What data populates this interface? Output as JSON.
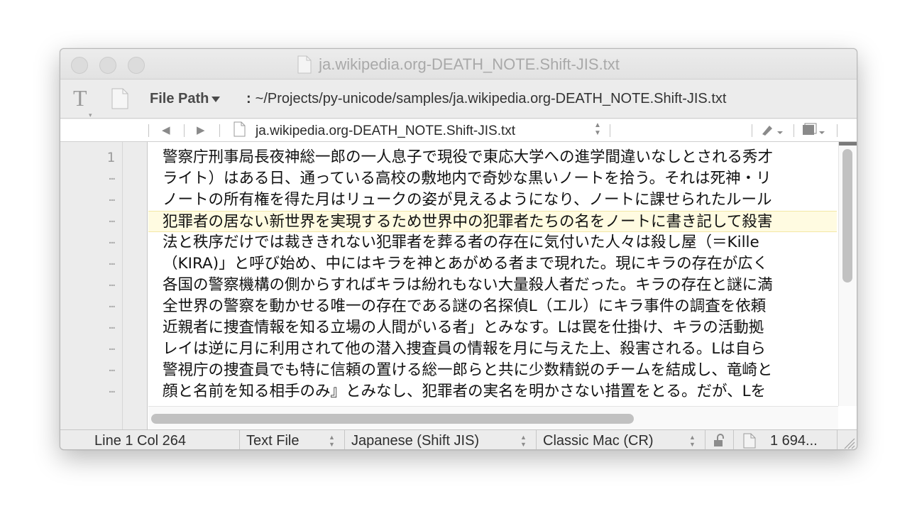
{
  "window": {
    "title": "ja.wikipedia.org-DEATH_NOTE.Shift-JIS.txt"
  },
  "pathbar": {
    "label": "File Path",
    "colon": ":",
    "value": "~/Projects/py-unicode/samples/ja.wikipedia.org-DEATH_NOTE.Shift-JIS.txt"
  },
  "navbar": {
    "filename": "ja.wikipedia.org-DEATH_NOTE.Shift-JIS.txt"
  },
  "editor": {
    "line_numbers": [
      "1",
      "…",
      "…",
      "…",
      "…",
      "…",
      "…",
      "…",
      "…",
      "…",
      "…",
      "…"
    ],
    "lines": [
      "警察庁刑事局長夜神総一郎の一人息子で現役で東応大学への進学間違いなしとされる秀才",
      "ライト）はある日、通っている高校の敷地内で奇妙な黒いノートを拾う。それは死神・リ",
      "ノートの所有権を得た月はリュークの姿が見えるようになり、ノートに課せられたルール",
      "犯罪者の居ない新世界を実現するため世界中の犯罪者たちの名をノートに書き記して殺害",
      "法と秩序だけでは裁ききれない犯罪者を葬る者の存在に気付いた人々は殺し屋（＝Kille",
      "（KIRA)」と呼び始め、中にはキラを神とあがめる者まで現れた。現にキラの存在が広く",
      "各国の警察機構の側からすればキラは紛れもない大量殺人者だった。キラの存在と謎に満",
      "全世界の警察を動かせる唯一の存在である謎の名探偵L（エル）にキラ事件の調査を依頼",
      "近親者に捜査情報を知る立場の人間がいる者」とみなす。Lは罠を仕掛け、キラの活動拠",
      "レイは逆に月に利用されて他の潜入捜査員の情報を月に与えた上、殺害される。Lは自ら",
      "警視庁の捜査員でも特に信頼の置ける総一郎らと共に少数精鋭のチームを結成し、竜崎と",
      "顔と名前を知る相手のみ』とみなし、犯罪者の実名を明かさない措置をとる。だが、Lを"
    ]
  },
  "statusbar": {
    "position": "Line 1 Col 264",
    "file_type": "Text File",
    "encoding": "Japanese (Shift JIS)",
    "line_endings": "Classic Mac (CR)",
    "file_size": "1 694..."
  }
}
